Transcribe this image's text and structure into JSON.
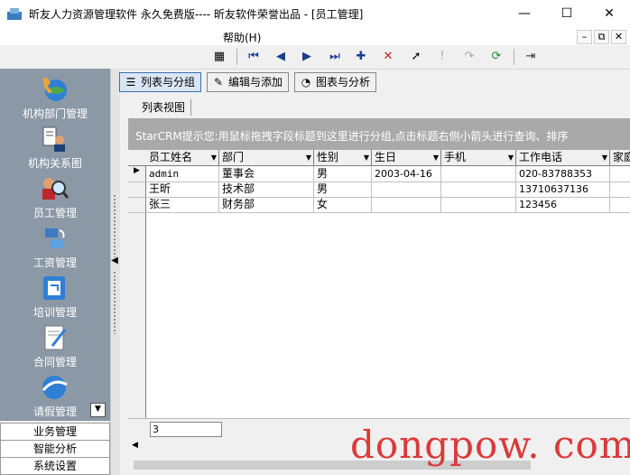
{
  "window": {
    "title": "昕友人力资源管理软件 永久免费版---- 昕友软件荣誉出品  - [员工管理]",
    "minimize": "—",
    "maximize": "☐",
    "close": "✕"
  },
  "menu": {
    "help": "帮助(H)",
    "mdi": [
      "–",
      "⧉",
      "✕"
    ]
  },
  "toolbar": {
    "buttons": [
      {
        "name": "grid-view-icon",
        "glyph": "▦"
      },
      {
        "name": "first-record-icon",
        "glyph": "⏮"
      },
      {
        "name": "prev-record-icon",
        "glyph": "◀"
      },
      {
        "name": "next-record-icon",
        "glyph": "▶"
      },
      {
        "name": "last-record-icon",
        "glyph": "⏭"
      },
      {
        "name": "add-record-icon",
        "glyph": "✚"
      },
      {
        "name": "delete-record-icon",
        "glyph": "✕"
      },
      {
        "name": "edit-cursor-icon",
        "glyph": "➚"
      },
      {
        "name": "post-disabled-icon",
        "glyph": "!"
      },
      {
        "name": "cancel-disabled-icon",
        "glyph": "↷"
      },
      {
        "name": "refresh-icon",
        "glyph": "⟳"
      },
      {
        "name": "exit-icon",
        "glyph": "⇥"
      }
    ]
  },
  "sidebar": {
    "items": [
      {
        "label": "机构部门管理",
        "icon": "globe-phone-icon"
      },
      {
        "label": "机构关系图",
        "icon": "org-chart-icon"
      },
      {
        "label": "员工管理",
        "icon": "employee-search-icon"
      },
      {
        "label": "工资管理",
        "icon": "salary-icon"
      },
      {
        "label": "培训管理",
        "icon": "training-icon"
      },
      {
        "label": "合同管理",
        "icon": "contract-icon"
      },
      {
        "label": "请假管理",
        "icon": "leave-icon"
      }
    ],
    "groups": [
      "业务管理",
      "智能分析",
      "系统设置"
    ]
  },
  "view_tabs": [
    "列表与分组",
    "编辑与添加",
    "图表与分析"
  ],
  "subtab": "列表视图",
  "hint": "StarCRM提示您:用鼠标拖拽字段标题到这里进行分组,点击标题右侧小箭头进行查询、排序",
  "columns": [
    "员工姓名",
    "部门",
    "性别",
    "生日",
    "手机",
    "工作电话",
    "家庭"
  ],
  "rows": [
    [
      "admin",
      "董事会",
      "男",
      "2003-04-16",
      "",
      "020-83788353",
      ""
    ],
    [
      "王昕",
      "技术部",
      "男",
      "",
      "",
      "13710637136",
      ""
    ],
    [
      "张三",
      "财务部",
      "女",
      "",
      "",
      "123456",
      ""
    ]
  ],
  "footer_count": "3",
  "watermark": "dongpow. com",
  "colors": {
    "sidebar": "#8b98a6",
    "hint_bar": "#a9a9a9",
    "watermark": "#d93a3a"
  }
}
